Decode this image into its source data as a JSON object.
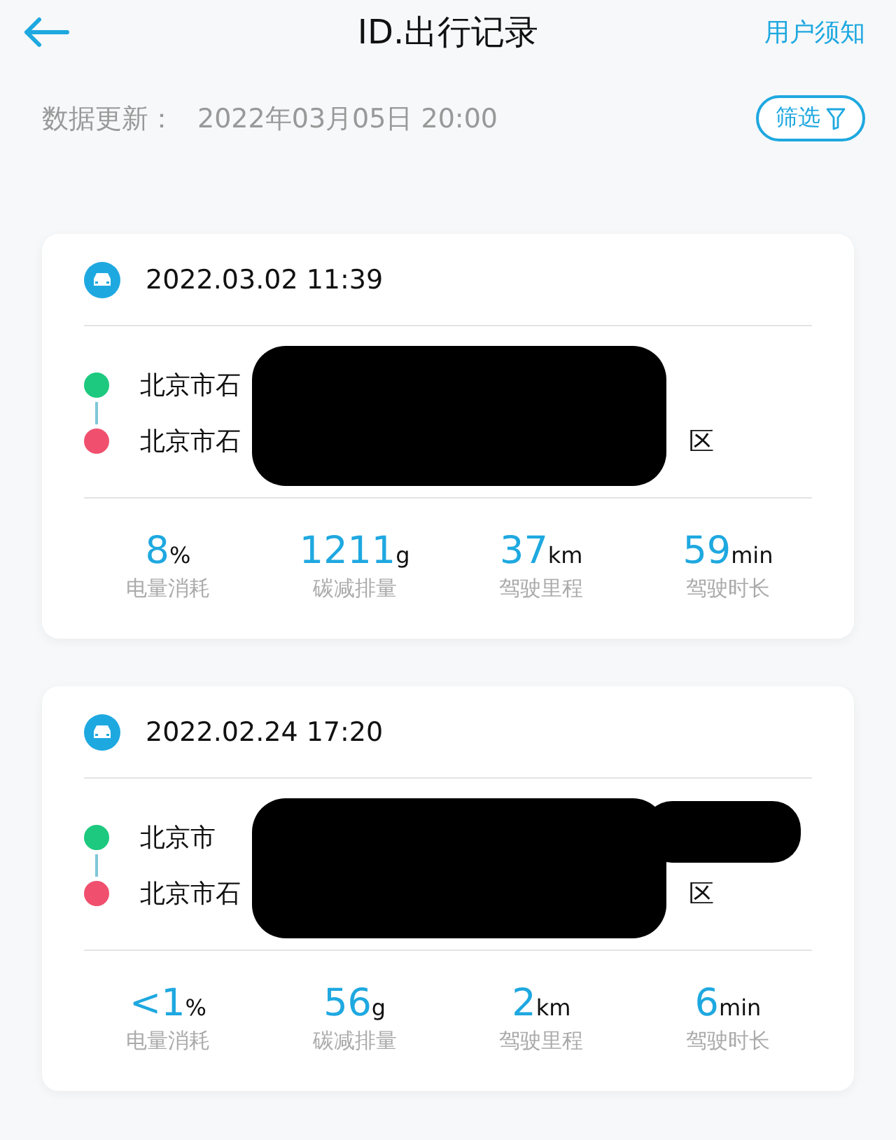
{
  "header": {
    "title": "ID.出行记录",
    "notice_link": "用户须知"
  },
  "update": {
    "label": "数据更新：",
    "time": "2022年03月05日 20:00",
    "filter_button": "筛选"
  },
  "trips": [
    {
      "datetime": "2022.03.02 11:39",
      "start": {
        "text": "北京市石"
      },
      "end": {
        "text": "北京市石",
        "end_text": "区"
      },
      "stats": [
        {
          "value": "8",
          "unit": "%",
          "label": "电量消耗"
        },
        {
          "value": "1211",
          "unit": "g",
          "label": "碳减排量"
        },
        {
          "value": "37",
          "unit": "km",
          "label": "驾驶里程"
        },
        {
          "value": "59",
          "unit": "min",
          "label": "驾驶时长"
        }
      ]
    },
    {
      "datetime": "2022.02.24 17:20",
      "start": {
        "text": "北京市"
      },
      "end": {
        "text": "北京市石",
        "end_text": "区"
      },
      "stats": [
        {
          "value": "<1",
          "unit": "%",
          "label": "电量消耗"
        },
        {
          "value": "56",
          "unit": "g",
          "label": "碳减排量"
        },
        {
          "value": "2",
          "unit": "km",
          "label": "驾驶里程"
        },
        {
          "value": "6",
          "unit": "min",
          "label": "驾驶时长"
        }
      ]
    }
  ]
}
